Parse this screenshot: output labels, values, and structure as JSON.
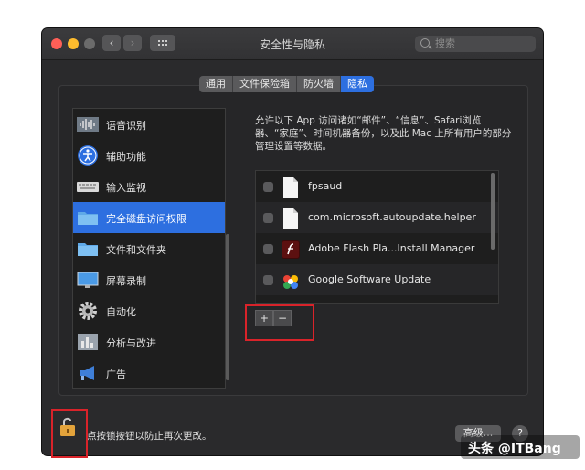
{
  "window": {
    "title": "安全性与隐私"
  },
  "toolbar": {
    "back": "‹",
    "forward": "›",
    "search_placeholder": "搜索"
  },
  "tabs": [
    {
      "label": "通用",
      "active": false
    },
    {
      "label": "文件保险箱",
      "active": false
    },
    {
      "label": "防火墙",
      "active": false
    },
    {
      "label": "隐私",
      "active": true
    }
  ],
  "sidebar": {
    "items": [
      {
        "label": "语音识别",
        "icon": "waveform-icon"
      },
      {
        "label": "辅助功能",
        "icon": "accessibility-icon"
      },
      {
        "label": "输入监视",
        "icon": "keyboard-icon"
      },
      {
        "label": "完全磁盘访问权限",
        "icon": "folder-icon",
        "selected": true
      },
      {
        "label": "文件和文件夹",
        "icon": "folder-icon"
      },
      {
        "label": "屏幕录制",
        "icon": "display-icon"
      },
      {
        "label": "自动化",
        "icon": "gear-icon"
      },
      {
        "label": "分析与改进",
        "icon": "chart-icon"
      },
      {
        "label": "广告",
        "icon": "megaphone-icon"
      }
    ]
  },
  "main": {
    "description": "允许以下 App 访问诸如“邮件”、“信息”、Safari浏览器、“家庭”、时间机器备份，以及此 Mac 上所有用户的部分管理设置等数据。",
    "apps": [
      {
        "name": "fpsaud",
        "icon": "document-icon",
        "checked": false
      },
      {
        "name": "com.microsoft.autoupdate.helper",
        "icon": "document-icon",
        "checked": false
      },
      {
        "name": "Adobe Flash Pla...Install Manager",
        "icon": "flash-icon",
        "checked": false
      },
      {
        "name": "Google Software Update",
        "icon": "google-update-icon",
        "checked": false
      }
    ],
    "add": "+",
    "remove": "−"
  },
  "footer": {
    "lock_message": "点按锁按钮以防止再次更改。",
    "advanced": "高级...",
    "help": "?"
  },
  "watermark": "头条 @ITBang",
  "colors": {
    "accent": "#2d6fe0",
    "highlight": "#d9232a"
  }
}
